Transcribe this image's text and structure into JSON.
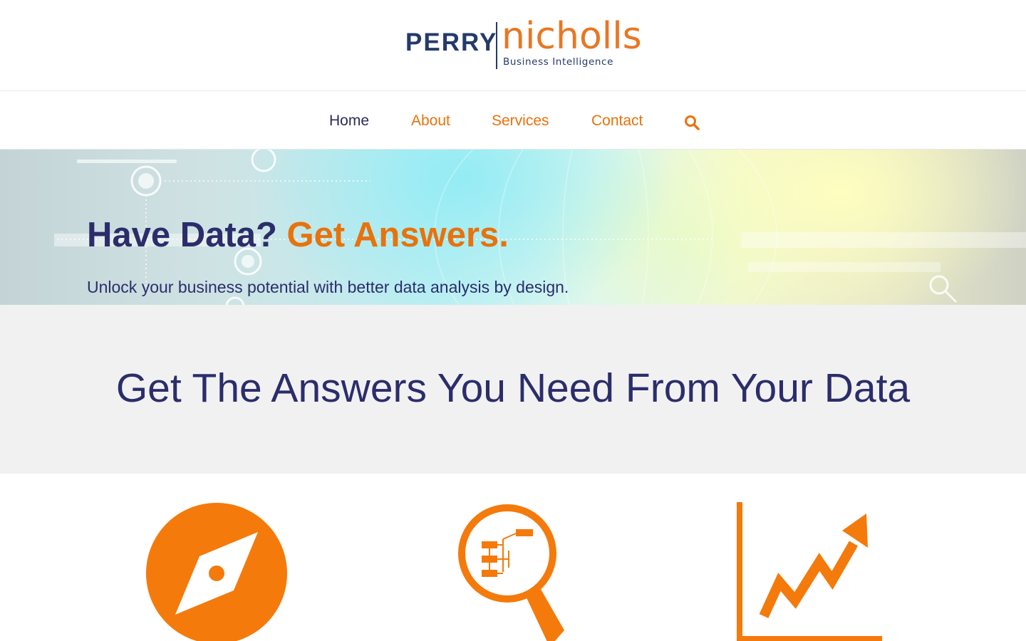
{
  "brand": {
    "name_primary": "PERRY",
    "name_secondary": "nicholls",
    "tagline": "Business Intelligence",
    "colors": {
      "navy": "#243a6a",
      "orange": "#e87722"
    }
  },
  "nav": {
    "items": [
      {
        "label": "Home",
        "active": true
      },
      {
        "label": "About",
        "active": false
      },
      {
        "label": "Services",
        "active": false
      },
      {
        "label": "Contact",
        "active": false
      }
    ],
    "search_icon": "search-icon"
  },
  "hero": {
    "title_prefix": "Have Data?",
    "title_accent": "Get Answers.",
    "subtitle": "Unlock your business potential with better data analysis by design."
  },
  "intro": {
    "heading": "Get The Answers You Need From Your Data"
  },
  "features": [
    {
      "icon": "compass-icon"
    },
    {
      "icon": "magnifier-flowchart-icon"
    },
    {
      "icon": "growth-chart-icon"
    }
  ]
}
